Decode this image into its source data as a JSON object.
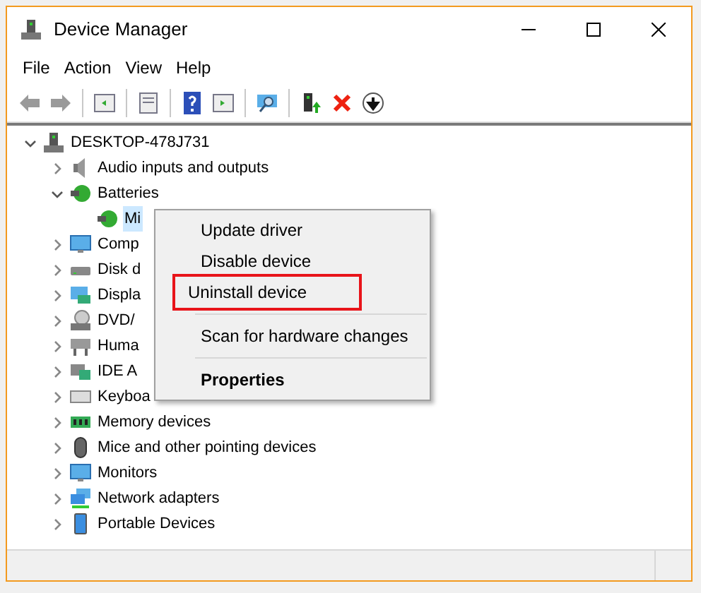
{
  "window": {
    "title": "Device Manager"
  },
  "menu_bar": [
    "File",
    "Action",
    "View",
    "Help"
  ],
  "toolbar": [
    {
      "kind": "back",
      "disabled": true
    },
    {
      "kind": "forward",
      "disabled": true
    },
    {
      "kind": "separator"
    },
    {
      "kind": "panel"
    },
    {
      "kind": "separator"
    },
    {
      "kind": "properties"
    },
    {
      "kind": "separator"
    },
    {
      "kind": "help"
    },
    {
      "kind": "panel2"
    },
    {
      "kind": "separator"
    },
    {
      "kind": "scan"
    },
    {
      "kind": "separator"
    },
    {
      "kind": "update"
    },
    {
      "kind": "remove"
    },
    {
      "kind": "download"
    }
  ],
  "tree": [
    {
      "label": "DESKTOP-478J731",
      "kind": "computer",
      "expanded": true,
      "selected": false,
      "children": [
        {
          "label": "Audio inputs and outputs",
          "kind": "audio",
          "expanded": false,
          "selected": false
        },
        {
          "label": "Batteries",
          "kind": "battery",
          "expanded": true,
          "selected": false,
          "children": [
            {
              "label": "Mi",
              "kind": "battery",
              "selected": true
            }
          ]
        },
        {
          "label": "Comp",
          "kind": "monitor",
          "expanded": false,
          "selected": false
        },
        {
          "label": "Disk d",
          "kind": "disk",
          "expanded": false,
          "selected": false
        },
        {
          "label": "Displa",
          "kind": "display",
          "expanded": false,
          "selected": false
        },
        {
          "label": "DVD/",
          "kind": "dvd",
          "expanded": false,
          "selected": false
        },
        {
          "label": "Huma",
          "kind": "hid",
          "expanded": false,
          "selected": false
        },
        {
          "label": "IDE A",
          "kind": "ide",
          "expanded": false,
          "selected": false
        },
        {
          "label": "Keyboa",
          "kind": "keyboard",
          "expanded": false,
          "selected": false
        },
        {
          "label": "Memory devices",
          "kind": "memory",
          "expanded": false,
          "selected": false
        },
        {
          "label": "Mice and other pointing devices",
          "kind": "mouse",
          "expanded": false,
          "selected": false
        },
        {
          "label": "Monitors",
          "kind": "monitor",
          "expanded": false,
          "selected": false
        },
        {
          "label": "Network adapters",
          "kind": "network",
          "expanded": false,
          "selected": false
        },
        {
          "label": "Portable Devices",
          "kind": "portable",
          "expanded": false,
          "selected": false
        }
      ]
    }
  ],
  "context_menu": [
    {
      "kind": "item",
      "label": "Update driver",
      "highlighted": false
    },
    {
      "kind": "item",
      "label": "Disable device",
      "highlighted": false
    },
    {
      "kind": "item",
      "label": "Uninstall device",
      "highlighted": true
    },
    {
      "kind": "separator"
    },
    {
      "kind": "item",
      "label": "Scan for hardware changes",
      "highlighted": false
    },
    {
      "kind": "separator"
    },
    {
      "kind": "default",
      "label": "Properties",
      "highlighted": false
    }
  ]
}
